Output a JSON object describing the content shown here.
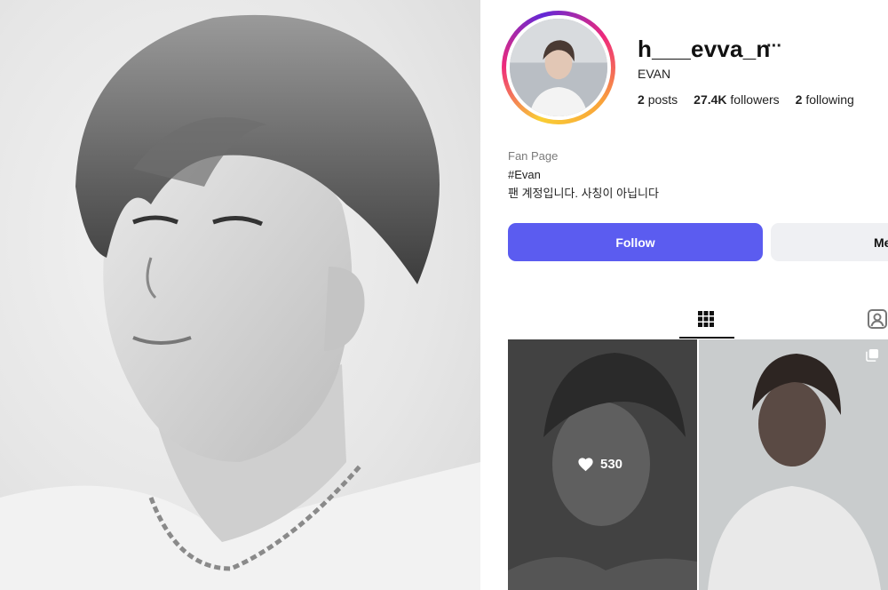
{
  "profile": {
    "username": "h___evva_n",
    "more_icon": "more-horizontal-icon",
    "more_glyph": "···",
    "display_name": "EVAN",
    "stats": {
      "posts_count": "2",
      "posts_label": "posts",
      "followers_count": "27.4K",
      "followers_label": "followers",
      "following_count": "2",
      "following_label": "following"
    },
    "category": "Fan Page",
    "bio": {
      "hashtag": "#Evan",
      "text": "팬 계정입니다. 사칭이 아닙니다"
    }
  },
  "actions": {
    "follow_label": "Follow",
    "message_label": "Me",
    "follow_color": "#5b5cf0"
  },
  "tabs": {
    "grid_icon": "grid-icon",
    "tagged_icon": "tagged-person-icon"
  },
  "posts": [
    {
      "likes": "530",
      "like_icon": "heart-icon"
    },
    {
      "multi_icon": "multiple-images-icon"
    }
  ],
  "colors": {
    "accent": "#5b5cf0",
    "secondary_button": "#eff0f3",
    "ring": [
      "#f9ce34",
      "#ee2a7b",
      "#6228d7"
    ]
  }
}
